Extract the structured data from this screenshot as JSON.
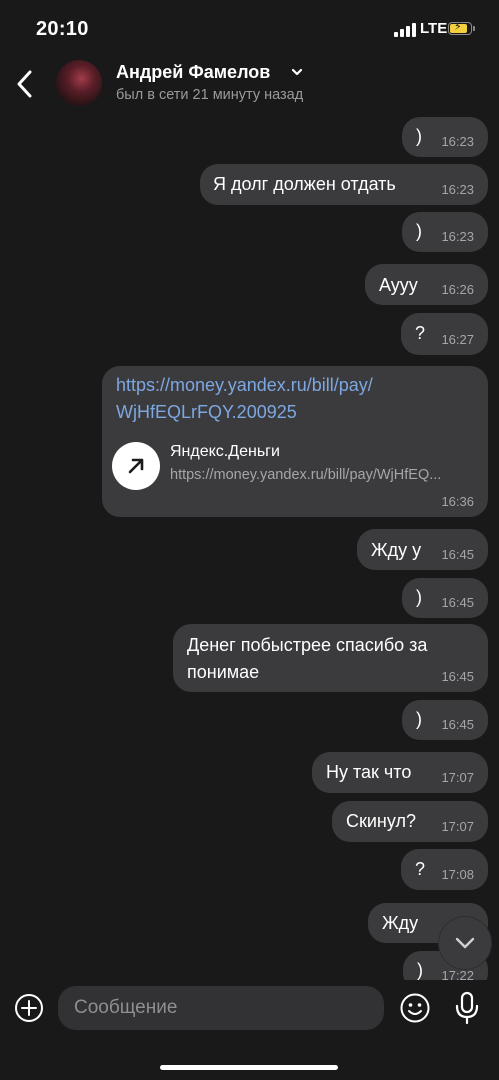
{
  "status_bar": {
    "time": "20:10",
    "network": "LTE",
    "battery_level": 0.76,
    "battery_color": "#f4d03f"
  },
  "header": {
    "contact_name": "Андрей Фамелов",
    "presence": "был в сети 21 минуту назад"
  },
  "messages": [
    {
      "text": ")",
      "time": "16:23"
    },
    {
      "text": "Я долг должен отдать",
      "time": "16:23"
    },
    {
      "text": ")",
      "time": "16:23"
    },
    {
      "text": "Аууу",
      "time": "16:26"
    },
    {
      "text": "?",
      "time": "16:27"
    },
    {
      "link_lines": [
        "https://money.yandex.ru/bill/pay/",
        "WjHfEQLrFQY.200925"
      ],
      "preview_title": "Яндекс.Деньги",
      "preview_url": "https://money.yandex.ru/bill/pay/WjHfEQ...",
      "time": "16:36"
    },
    {
      "text": "Жду у",
      "time": "16:45"
    },
    {
      "text": ")",
      "time": "16:45"
    },
    {
      "lines": [
        "Денег побыстрее спасибо за",
        "понимае"
      ],
      "time": "16:45"
    },
    {
      "text": ")",
      "time": "16:45"
    },
    {
      "text": "Ну так что",
      "time": "17:07"
    },
    {
      "text": "Скинул?",
      "time": "17:07"
    },
    {
      "text": "?",
      "time": "17:08"
    },
    {
      "text": "Жду",
      "time": "1"
    },
    {
      "text": ")",
      "time": "17:22"
    }
  ],
  "composer": {
    "placeholder": "Сообщение"
  },
  "colors": {
    "background": "#19191a",
    "bubble": "#3b3b3e",
    "link": "#7da7e0",
    "timestamp": "#a6a6aa"
  }
}
